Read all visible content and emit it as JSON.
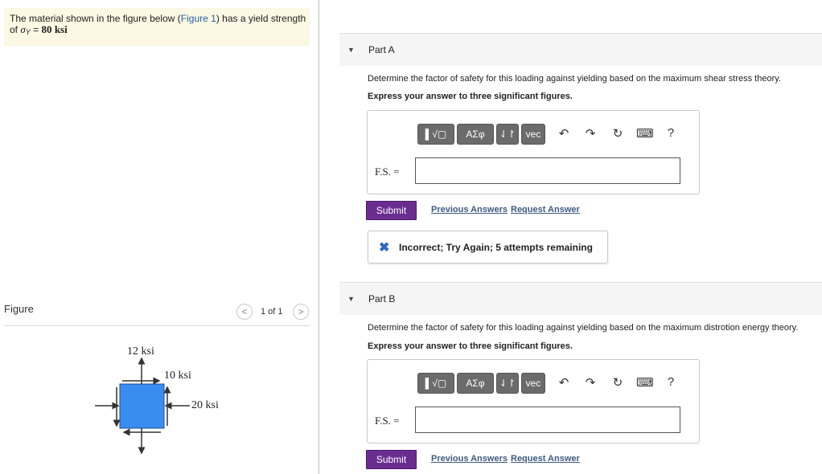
{
  "problem": {
    "text_before": "The material shown in the figure below (",
    "figure_link": "Figure 1",
    "text_after": ") has a yield strength",
    "line2_prefix": "of ",
    "sigma": "σ",
    "sub": "Y",
    "equals": " = ",
    "value": "80",
    "unit": "ksi"
  },
  "figure": {
    "label": "Figure",
    "pager": "1 of 1",
    "prev": "<",
    "next": ">",
    "stress_top": "12 ksi",
    "stress_right_upper": "10 ksi",
    "stress_right": "20 ksi",
    "block_color": "#3a8df0"
  },
  "toolbar": {
    "templates": "▌√▢",
    "greek": "ΑΣφ",
    "arrows": "⇃↾",
    "vec": "vec",
    "undo": "↶",
    "redo": "↷",
    "reset": "↻",
    "keyboard": "⌨",
    "help": "?"
  },
  "partA": {
    "caret": "▼",
    "title": "Part A",
    "question": "Determine the factor of safety for this loading against yielding based on the maximum shear stress theory.",
    "instruction": "Express your answer to three significant figures.",
    "label": "F.S. =",
    "value": "",
    "submit": "Submit",
    "previous": "Previous Answers",
    "request": "Request Answer",
    "feedback_icon": "✖",
    "feedback": "Incorrect; Try Again; 5 attempts remaining"
  },
  "partB": {
    "caret": "▼",
    "title": "Part B",
    "question": "Determine the factor of safety for this loading against yielding based on the maximum distrotion energy theory.",
    "instruction": "Express your answer to three significant figures.",
    "label": "F.S. =",
    "value": "",
    "submit": "Submit",
    "previous": "Previous Answers",
    "request": "Request Answer"
  }
}
